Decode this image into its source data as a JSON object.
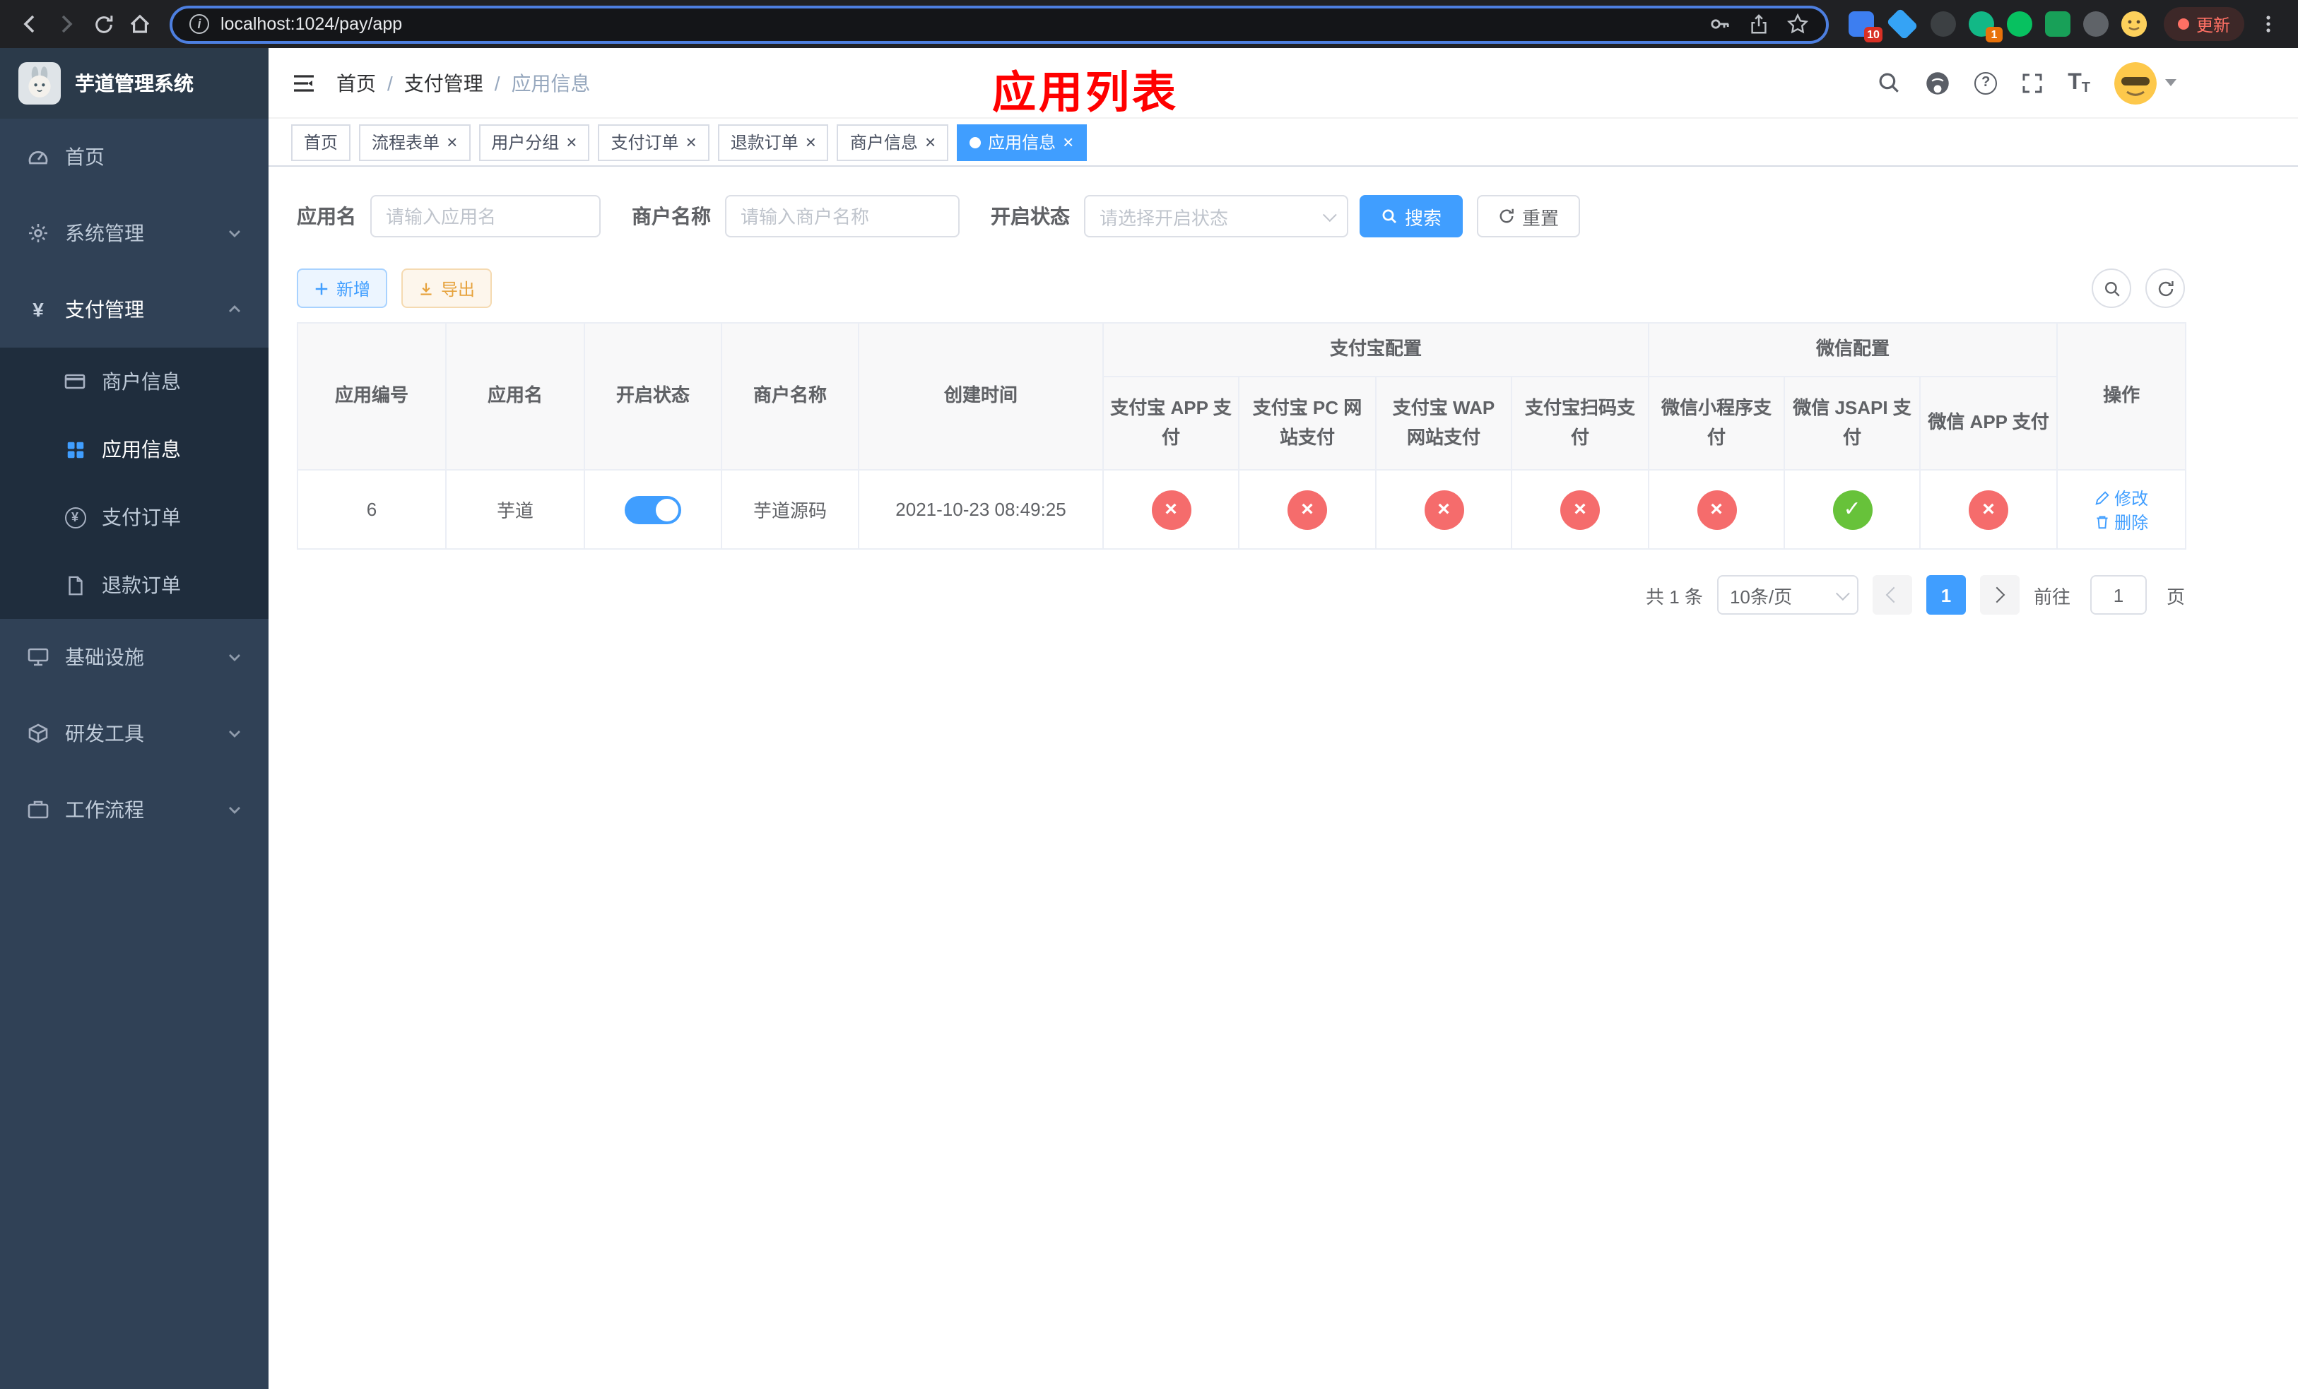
{
  "browser": {
    "url": "localhost:1024/pay/app",
    "update_label": "更新",
    "ext_badge_1": "10",
    "ext_badge_2": "1"
  },
  "sidebar": {
    "logo_title": "芋道管理系统",
    "home": "首页",
    "system": "系统管理",
    "payment": "支付管理",
    "merchant_info": "商户信息",
    "app_info": "应用信息",
    "pay_order": "支付订单",
    "refund_order": "退款订单",
    "infra": "基础设施",
    "dev_tools": "研发工具",
    "workflow": "工作流程"
  },
  "header": {
    "breadcrumb_home": "首页",
    "breadcrumb_module": "支付管理",
    "breadcrumb_page": "应用信息",
    "separator": "/",
    "annotation": "应用列表"
  },
  "tabs": {
    "items": [
      "首页",
      "流程表单",
      "用户分组",
      "支付订单",
      "退款订单",
      "商户信息",
      "应用信息"
    ]
  },
  "filters": {
    "app_name_label": "应用名",
    "app_name_placeholder": "请输入应用名",
    "merchant_label": "商户名称",
    "merchant_placeholder": "请输入商户名称",
    "status_label": "开启状态",
    "status_placeholder": "请选择开启状态",
    "search_label": "搜索",
    "reset_label": "重置"
  },
  "toolbar": {
    "add_label": "新增",
    "export_label": "导出"
  },
  "table": {
    "group_alipay": "支付宝配置",
    "group_wechat": "微信配置",
    "col_id": "应用编号",
    "col_name": "应用名",
    "col_status": "开启状态",
    "col_merchant": "商户名称",
    "col_created": "创建时间",
    "col_alipay_app": "支付宝 APP 支付",
    "col_alipay_pc": "支付宝 PC 网站支付",
    "col_alipay_wap": "支付宝 WAP 网站支付",
    "col_alipay_qr": "支付宝扫码支付",
    "col_wechat_lite": "微信小程序支付",
    "col_wechat_jsapi": "微信 JSAPI 支付",
    "col_wechat_app": "微信 APP 支付",
    "col_action": "操作",
    "row": {
      "id": "6",
      "name": "芋道",
      "merchant": "芋道源码",
      "created": "2021-10-23 08:49:25",
      "edit_label": "修改",
      "delete_label": "删除"
    }
  },
  "pagination": {
    "total": "共 1 条",
    "page_size": "10条/页",
    "page": "1",
    "goto_label": "前往",
    "goto_value": "1",
    "page_unit": "页"
  },
  "icons": {
    "check": "✓",
    "cross": "×",
    "close": "×",
    "yen": "¥",
    "question": "?",
    "info": "i",
    "font_glyph": "T"
  },
  "colors": {
    "primary": "#409eff",
    "success": "#67c23a",
    "danger": "#f56c6c",
    "warning": "#e6a23c",
    "sidebar_bg": "#304156",
    "submenu_bg": "#1f2d3d",
    "annotation_red": "#ff0000"
  }
}
